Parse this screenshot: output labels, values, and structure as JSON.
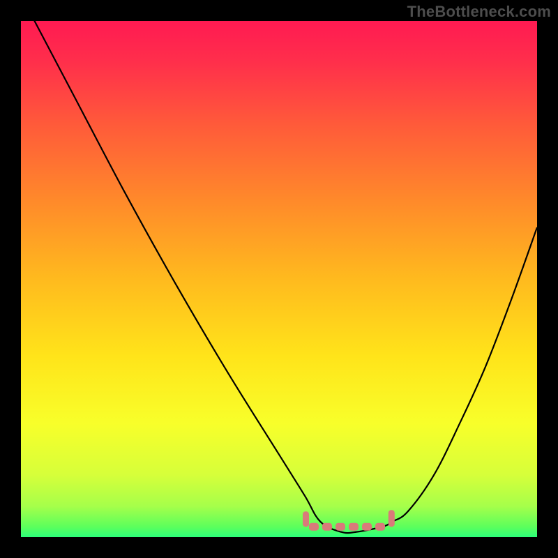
{
  "watermark": "TheBottleneck.com",
  "chart_data": {
    "type": "line",
    "title": "",
    "xlabel": "",
    "ylabel": "",
    "xlim": [
      0,
      100
    ],
    "ylim": [
      0,
      100
    ],
    "grid": false,
    "legend": false,
    "series": [
      {
        "name": "curve",
        "x": [
          0,
          10,
          20,
          30,
          40,
          50,
          55,
          58,
          62,
          65,
          70,
          72,
          75,
          80,
          85,
          90,
          95,
          100
        ],
        "values": [
          105,
          86,
          67,
          49,
          32,
          16,
          8,
          3,
          1,
          1,
          2,
          3,
          5,
          12,
          22,
          33,
          46,
          60
        ]
      }
    ],
    "flat_band": {
      "x_start": 55,
      "x_end": 72,
      "value": 2,
      "color": "#d97a7a"
    },
    "gradient_stops": [
      {
        "offset": 0.0,
        "color": "#ff1a52"
      },
      {
        "offset": 0.08,
        "color": "#ff2f4b"
      },
      {
        "offset": 0.2,
        "color": "#ff5a3a"
      },
      {
        "offset": 0.35,
        "color": "#ff8a2a"
      },
      {
        "offset": 0.5,
        "color": "#ffba1e"
      },
      {
        "offset": 0.65,
        "color": "#ffe41a"
      },
      {
        "offset": 0.78,
        "color": "#f8ff2a"
      },
      {
        "offset": 0.88,
        "color": "#d6ff3a"
      },
      {
        "offset": 0.94,
        "color": "#a6ff4a"
      },
      {
        "offset": 0.98,
        "color": "#5cff5c"
      },
      {
        "offset": 1.0,
        "color": "#2cff7a"
      }
    ]
  }
}
